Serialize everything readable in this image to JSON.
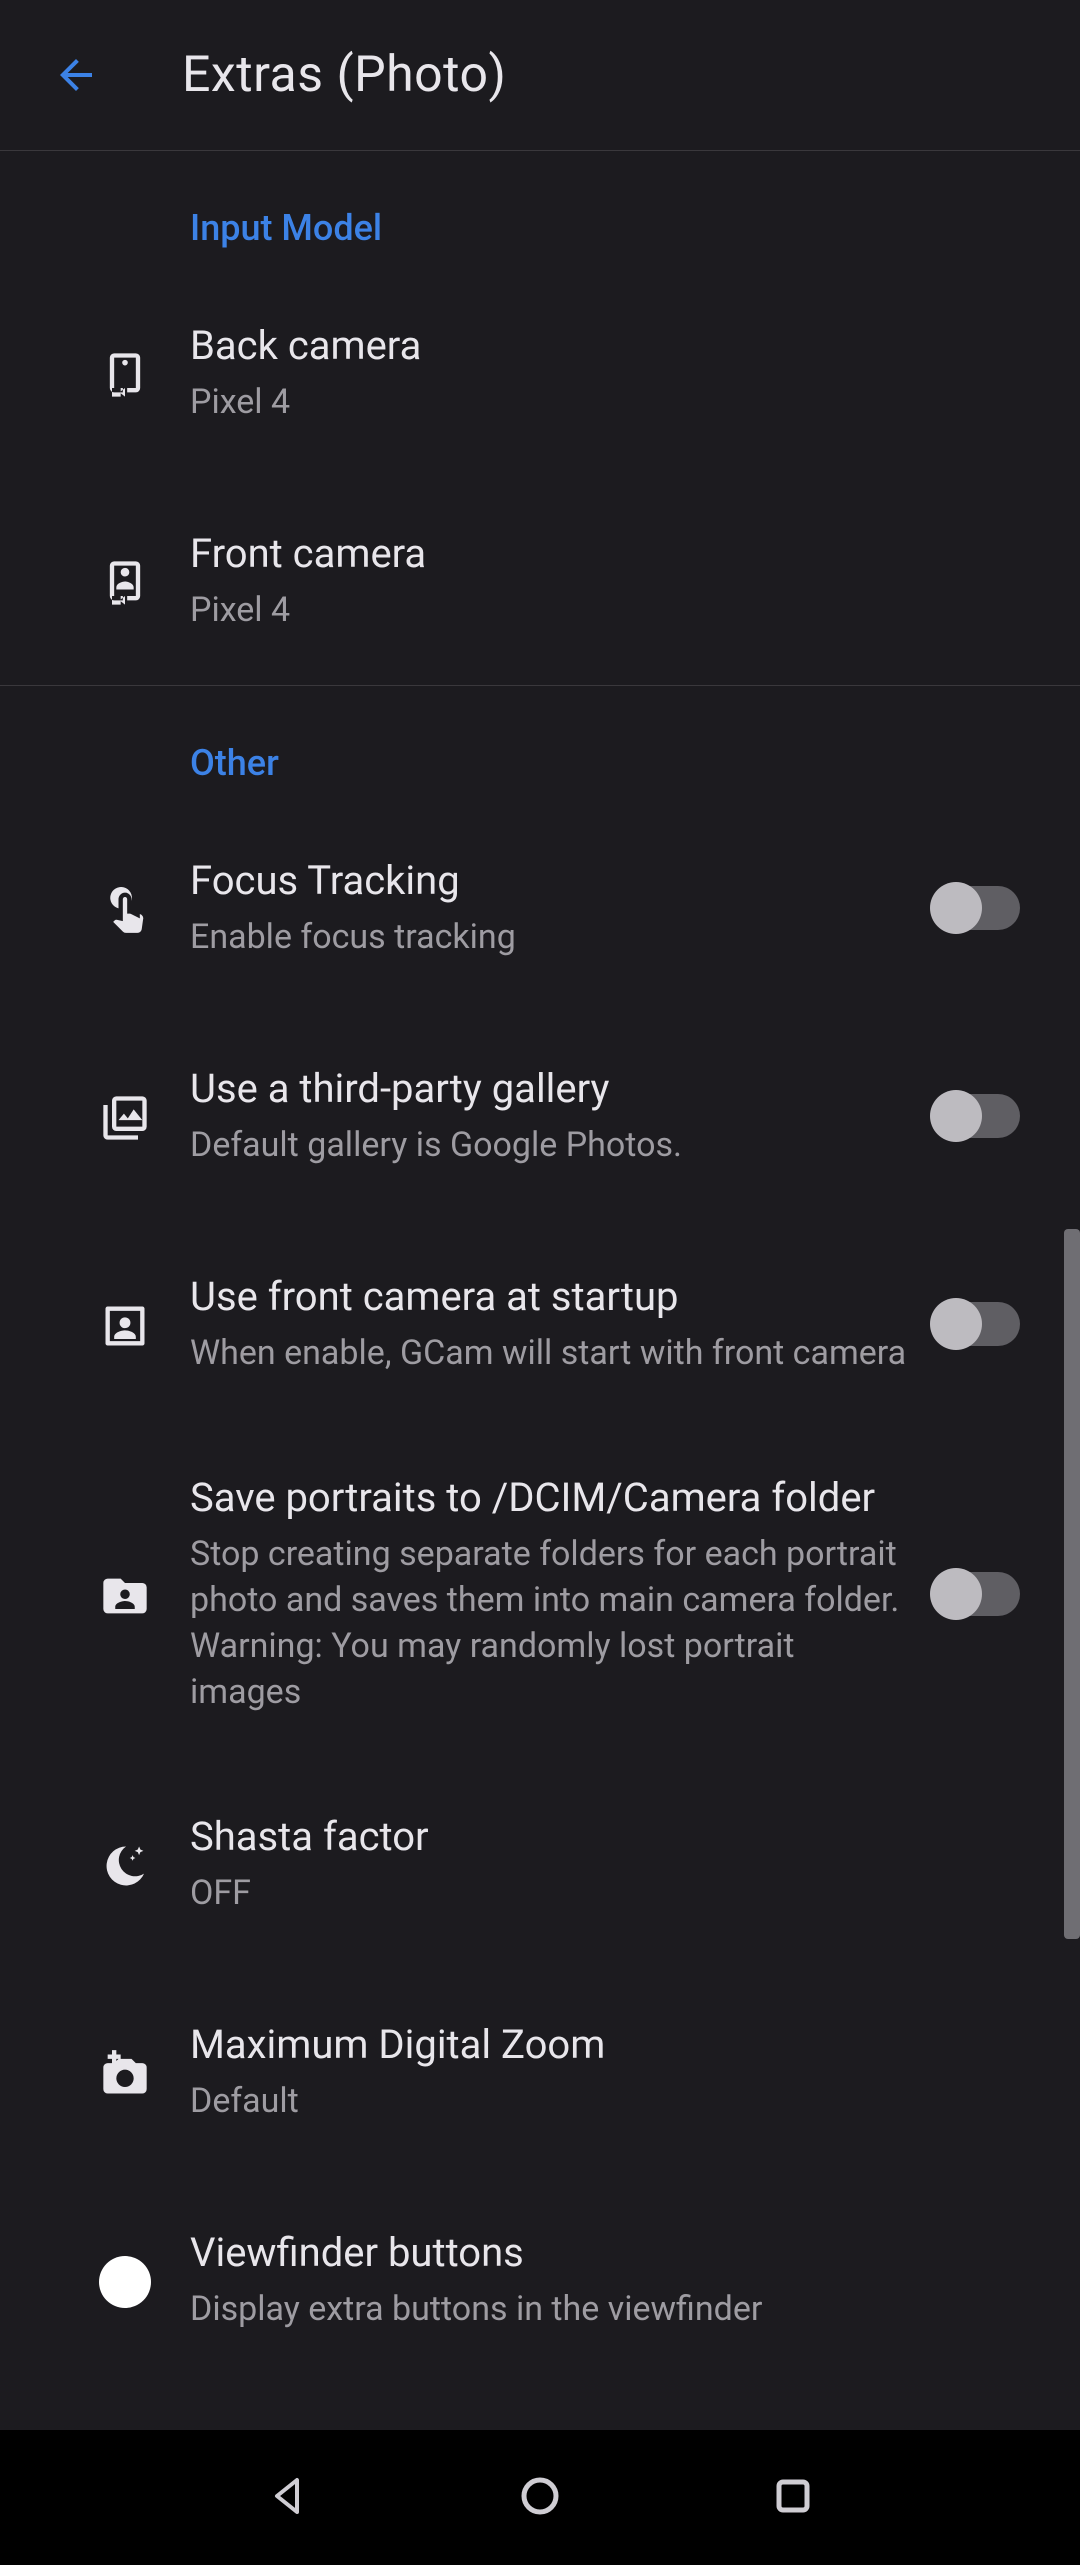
{
  "header": {
    "title": "Extras (Photo)"
  },
  "sections": {
    "input_model": {
      "label": "Input Model"
    },
    "other": {
      "label": "Other"
    }
  },
  "items": {
    "back_camera": {
      "title": "Back camera",
      "subtitle": "Pixel 4"
    },
    "front_camera": {
      "title": "Front camera",
      "subtitle": "Pixel 4"
    },
    "focus_tracking": {
      "title": "Focus Tracking",
      "subtitle": "Enable focus tracking",
      "toggle": false
    },
    "third_party_gallery": {
      "title": "Use a third-party gallery",
      "subtitle": "Default gallery is Google Photos.",
      "toggle": false
    },
    "front_on_start": {
      "title": "Use front camera at startup",
      "subtitle": "When enable, GCam will start with front camera",
      "toggle": false
    },
    "save_portraits": {
      "title": "Save portraits to /DCIM/Camera folder",
      "subtitle": "Stop creating separate folders for each portrait photo and saves them into main camera folder.\nWarning: You may randomly lost portrait images",
      "toggle": false
    },
    "shasta": {
      "title": "Shasta factor",
      "subtitle": "OFF"
    },
    "max_zoom": {
      "title": "Maximum Digital Zoom",
      "subtitle": "Default"
    },
    "viewfinder_buttons": {
      "title": "Viewfinder buttons",
      "subtitle": "Display extra buttons in the viewfinder"
    }
  }
}
